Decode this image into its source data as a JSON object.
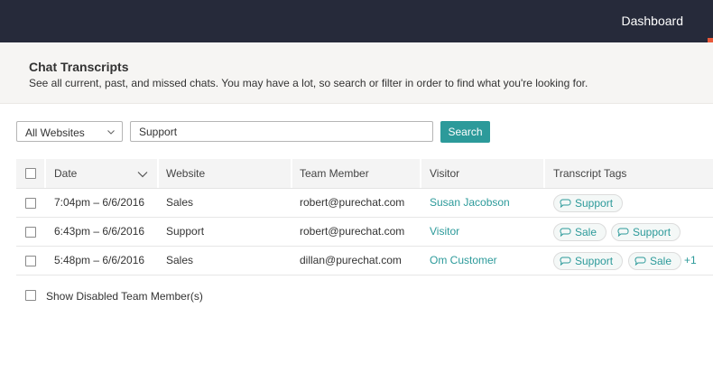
{
  "topbar": {
    "dashboard_label": "Dashboard"
  },
  "header": {
    "title": "Chat Transcripts",
    "subtitle": "See all current, past, and missed chats. You may have a lot, so search or filter in order to find what you're looking for."
  },
  "filters": {
    "website_select": {
      "selected": "All Websites"
    },
    "search_value": "Support",
    "search_button": "Search"
  },
  "table": {
    "columns": [
      "Date",
      "Website",
      "Team Member",
      "Visitor",
      "Transcript Tags"
    ],
    "rows": [
      {
        "date": "7:04pm – 6/6/2016",
        "website": "Sales",
        "team_member": "robert@purechat.com",
        "visitor": "Susan Jacobson",
        "tags": [
          "Support"
        ],
        "more": ""
      },
      {
        "date": "6:43pm – 6/6/2016",
        "website": "Support",
        "team_member": "robert@purechat.com",
        "visitor": "Visitor",
        "tags": [
          "Sale",
          "Support"
        ],
        "more": ""
      },
      {
        "date": "5:48pm – 6/6/2016",
        "website": "Sales",
        "team_member": "dillan@purechat.com",
        "visitor": "Om Customer",
        "tags": [
          "Support",
          "Sale"
        ],
        "more": "+1"
      }
    ]
  },
  "footer": {
    "show_disabled_label": "Show Disabled Team Member(s)"
  },
  "colors": {
    "topbar": "#262a3a",
    "accent": "#2c9a9a",
    "highlight": "#e8593a"
  },
  "icons": {
    "sort": "chevron-down-icon",
    "tag": "speech-bubble-icon"
  }
}
